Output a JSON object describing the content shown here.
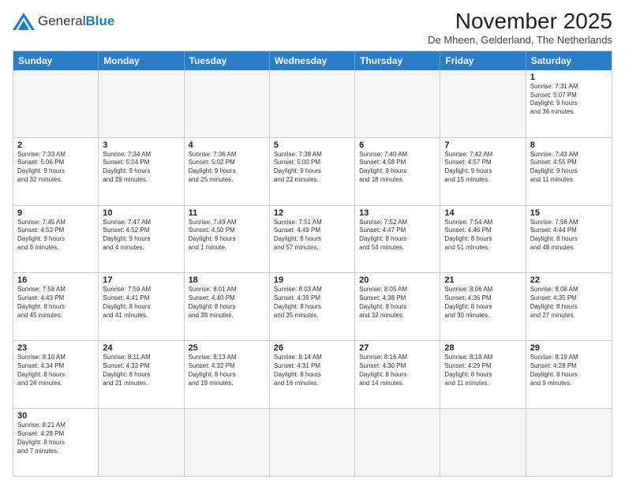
{
  "logo": {
    "general": "General",
    "blue": "Blue"
  },
  "title": "November 2025",
  "subtitle": "De Mheen, Gelderland, The Netherlands",
  "header_days": [
    "Sunday",
    "Monday",
    "Tuesday",
    "Wednesday",
    "Thursday",
    "Friday",
    "Saturday"
  ],
  "rows": [
    [
      {
        "day": "",
        "empty": true
      },
      {
        "day": "",
        "empty": true
      },
      {
        "day": "",
        "empty": true
      },
      {
        "day": "",
        "empty": true
      },
      {
        "day": "",
        "empty": true
      },
      {
        "day": "",
        "empty": true
      },
      {
        "day": "1",
        "info": "Sunrise: 7:31 AM\nSunset: 5:07 PM\nDaylight: 9 hours\nand 36 minutes."
      }
    ],
    [
      {
        "day": "2",
        "info": "Sunrise: 7:33 AM\nSunset: 5:06 PM\nDaylight: 9 hours\nand 32 minutes."
      },
      {
        "day": "3",
        "info": "Sunrise: 7:34 AM\nSunset: 5:04 PM\nDaylight: 9 hours\nand 29 minutes."
      },
      {
        "day": "4",
        "info": "Sunrise: 7:36 AM\nSunset: 5:02 PM\nDaylight: 9 hours\nand 25 minutes."
      },
      {
        "day": "5",
        "info": "Sunrise: 7:38 AM\nSunset: 5:00 PM\nDaylight: 9 hours\nand 22 minutes."
      },
      {
        "day": "6",
        "info": "Sunrise: 7:40 AM\nSunset: 4:58 PM\nDaylight: 9 hours\nand 18 minutes."
      },
      {
        "day": "7",
        "info": "Sunrise: 7:42 AM\nSunset: 4:57 PM\nDaylight: 9 hours\nand 15 minutes."
      },
      {
        "day": "8",
        "info": "Sunrise: 7:43 AM\nSunset: 4:55 PM\nDaylight: 9 hours\nand 11 minutes."
      }
    ],
    [
      {
        "day": "9",
        "info": "Sunrise: 7:45 AM\nSunset: 4:53 PM\nDaylight: 9 hours\nand 8 minutes."
      },
      {
        "day": "10",
        "info": "Sunrise: 7:47 AM\nSunset: 4:52 PM\nDaylight: 9 hours\nand 4 minutes."
      },
      {
        "day": "11",
        "info": "Sunrise: 7:49 AM\nSunset: 4:50 PM\nDaylight: 9 hours\nand 1 minute."
      },
      {
        "day": "12",
        "info": "Sunrise: 7:51 AM\nSunset: 4:49 PM\nDaylight: 8 hours\nand 57 minutes."
      },
      {
        "day": "13",
        "info": "Sunrise: 7:52 AM\nSunset: 4:47 PM\nDaylight: 8 hours\nand 54 minutes."
      },
      {
        "day": "14",
        "info": "Sunrise: 7:54 AM\nSunset: 4:46 PM\nDaylight: 8 hours\nand 51 minutes."
      },
      {
        "day": "15",
        "info": "Sunrise: 7:56 AM\nSunset: 4:44 PM\nDaylight: 8 hours\nand 48 minutes."
      }
    ],
    [
      {
        "day": "16",
        "info": "Sunrise: 7:58 AM\nSunset: 4:43 PM\nDaylight: 8 hours\nand 45 minutes."
      },
      {
        "day": "17",
        "info": "Sunrise: 7:59 AM\nSunset: 4:41 PM\nDaylight: 8 hours\nand 41 minutes."
      },
      {
        "day": "18",
        "info": "Sunrise: 8:01 AM\nSunset: 4:40 PM\nDaylight: 8 hours\nand 38 minutes."
      },
      {
        "day": "19",
        "info": "Sunrise: 8:03 AM\nSunset: 4:39 PM\nDaylight: 8 hours\nand 35 minutes."
      },
      {
        "day": "20",
        "info": "Sunrise: 8:05 AM\nSunset: 4:38 PM\nDaylight: 8 hours\nand 32 minutes."
      },
      {
        "day": "21",
        "info": "Sunrise: 8:06 AM\nSunset: 4:36 PM\nDaylight: 8 hours\nand 30 minutes."
      },
      {
        "day": "22",
        "info": "Sunrise: 8:08 AM\nSunset: 4:35 PM\nDaylight: 8 hours\nand 27 minutes."
      }
    ],
    [
      {
        "day": "23",
        "info": "Sunrise: 8:10 AM\nSunset: 4:34 PM\nDaylight: 8 hours\nand 24 minutes."
      },
      {
        "day": "24",
        "info": "Sunrise: 8:11 AM\nSunset: 4:33 PM\nDaylight: 8 hours\nand 21 minutes."
      },
      {
        "day": "25",
        "info": "Sunrise: 8:13 AM\nSunset: 4:32 PM\nDaylight: 8 hours\nand 19 minutes."
      },
      {
        "day": "26",
        "info": "Sunrise: 8:14 AM\nSunset: 4:31 PM\nDaylight: 8 hours\nand 16 minutes."
      },
      {
        "day": "27",
        "info": "Sunrise: 8:16 AM\nSunset: 4:30 PM\nDaylight: 8 hours\nand 14 minutes."
      },
      {
        "day": "28",
        "info": "Sunrise: 8:18 AM\nSunset: 4:29 PM\nDaylight: 8 hours\nand 11 minutes."
      },
      {
        "day": "29",
        "info": "Sunrise: 8:19 AM\nSunset: 4:28 PM\nDaylight: 8 hours\nand 9 minutes."
      }
    ],
    [
      {
        "day": "30",
        "info": "Sunrise: 8:21 AM\nSunset: 4:28 PM\nDaylight: 8 hours\nand 7 minutes."
      },
      {
        "day": "",
        "empty": true
      },
      {
        "day": "",
        "empty": true
      },
      {
        "day": "",
        "empty": true
      },
      {
        "day": "",
        "empty": true
      },
      {
        "day": "",
        "empty": true
      },
      {
        "day": "",
        "empty": true
      }
    ]
  ]
}
